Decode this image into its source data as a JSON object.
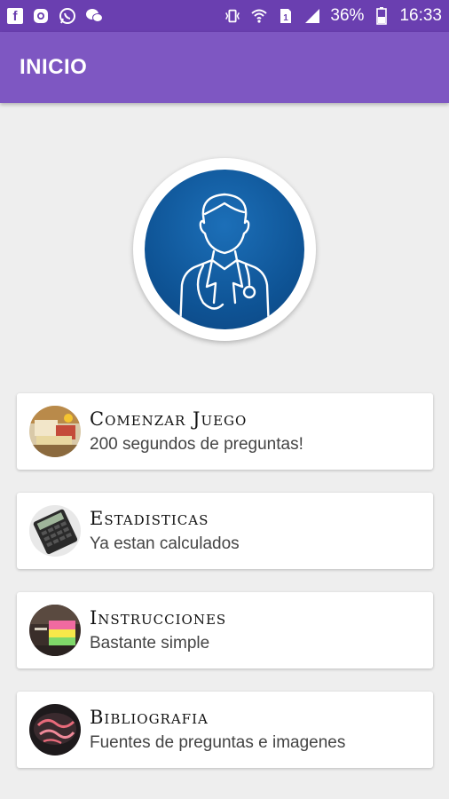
{
  "status_bar": {
    "battery": "36%",
    "time": "16:33",
    "left_icons": [
      "facebook-icon",
      "instagram-icon",
      "whatsapp-icon",
      "wechat-icon"
    ],
    "right_icons": [
      "vibrate-icon",
      "wifi-icon",
      "sim-icon",
      "signal-icon",
      "battery-icon"
    ]
  },
  "app_bar": {
    "title": "INICIO",
    "color": "#7e57c2"
  },
  "avatar": {
    "icon": "doctor-icon"
  },
  "menu": {
    "items": [
      {
        "title": "Comenzar Juego",
        "subtitle": "200 segundos de preguntas!",
        "thumb": "game-thumb"
      },
      {
        "title": "Estadisticas",
        "subtitle": "Ya estan calculados",
        "thumb": "calculator-thumb"
      },
      {
        "title": "Instrucciones",
        "subtitle": "Bastante simple",
        "thumb": "sticky-notes-thumb"
      },
      {
        "title": "Bibliografia",
        "subtitle": "Fuentes de preguntas e imagenes",
        "thumb": "books-thumb"
      }
    ]
  }
}
